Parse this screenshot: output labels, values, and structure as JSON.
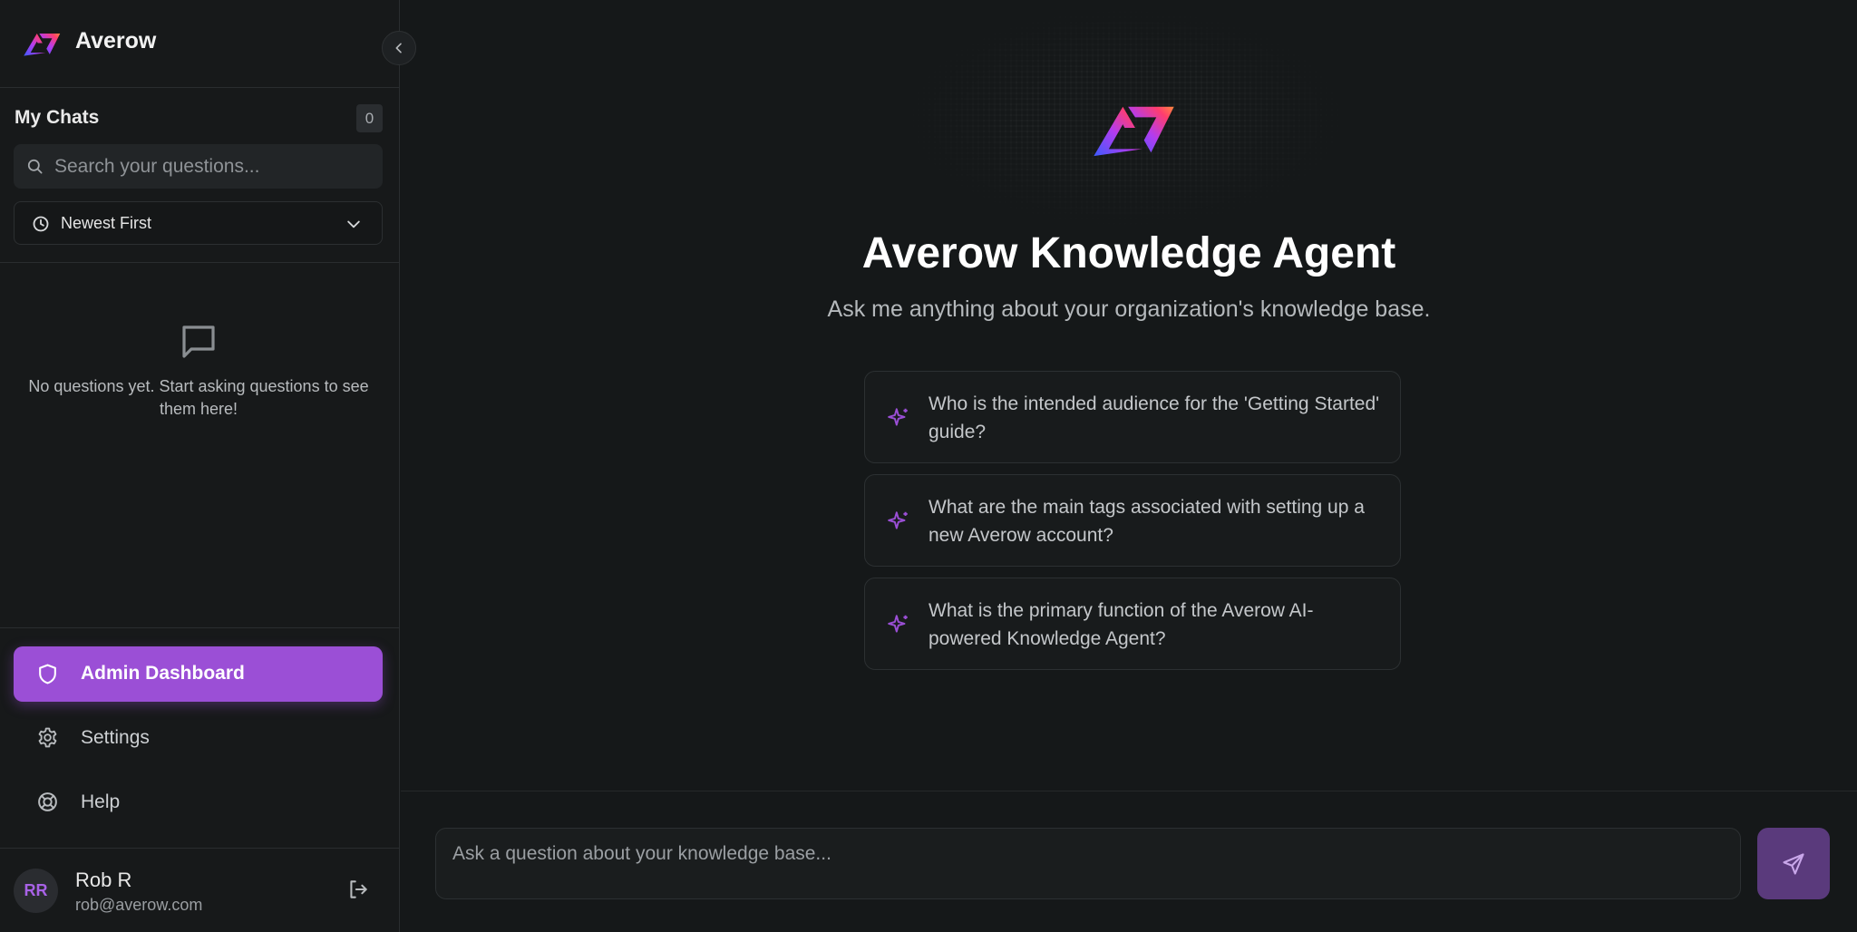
{
  "brand": {
    "name": "Averow"
  },
  "sidebar": {
    "my_chats_title": "My Chats",
    "chat_count": "0",
    "search_placeholder": "Search your questions...",
    "sort_label": "Newest First",
    "empty_message": "No questions yet. Start asking questions to see them here!",
    "nav": {
      "admin": "Admin Dashboard",
      "settings": "Settings",
      "help": "Help"
    },
    "user": {
      "initials": "RR",
      "name": "Rob R",
      "email": "rob@averow.com"
    }
  },
  "main": {
    "title": "Averow Knowledge Agent",
    "subtitle": "Ask me anything about your organization's knowledge base.",
    "suggestions": [
      "Who is the intended audience for the 'Getting Started' guide?",
      "What are the main tags associated with setting up a new Averow account?",
      "What is the primary function of the Averow AI-powered Knowledge Agent?"
    ],
    "ask_placeholder": "Ask a question about your knowledge base..."
  },
  "colors": {
    "accent": "#9b4fd6",
    "send_button": "#5a3a7c",
    "background": "#151819",
    "sidebar": "#17191a"
  }
}
